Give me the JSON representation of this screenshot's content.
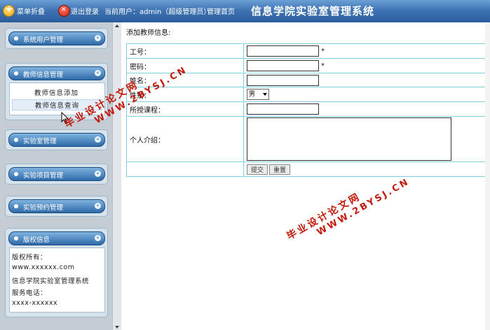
{
  "topbar": {
    "menu_toggle": "菜单折叠",
    "logout": "退出登录",
    "current_user": "当前用户：admin（超级管理员）",
    "admin_home": "管理首页",
    "system_title": "信息学院实验室管理系统"
  },
  "sidebar": {
    "panels": [
      {
        "label": "系统用户管理"
      },
      {
        "label": "教师信息管理",
        "items": [
          "教师信息添加",
          "教师信息查询"
        ]
      },
      {
        "label": "实验室管理"
      },
      {
        "label": "实验项目管理"
      },
      {
        "label": "实验预约管理"
      },
      {
        "label": "版权信息"
      }
    ],
    "copyright": {
      "line1": "版权所有：",
      "line2": "www.xxxxxx.com",
      "line3": "信息学院实验室管理系统",
      "line4": "服务电话：",
      "line5": "xxxx-xxxxxx"
    }
  },
  "main": {
    "title": "添加教师信息:",
    "fields": {
      "id_label": "工号：",
      "password_label": "密码：",
      "name_label": "姓名：",
      "gender_label": "性别：",
      "gender_value": "男",
      "course_label": "所授课程：",
      "intro_label": "个人介绍：",
      "required_mark": "*"
    },
    "submit_label": "提交",
    "reset_label": "重置"
  },
  "watermark": {
    "line1": "毕业设计论文网",
    "line2": "WWW.2BYSJ.CN"
  },
  "colors": {
    "topbar": "#3f74b3",
    "sidebar_bg": "#c5cdd4",
    "panel_header": "#2f6aa8",
    "table_border": "#7fd0e0",
    "watermark": "#c21a0c"
  }
}
